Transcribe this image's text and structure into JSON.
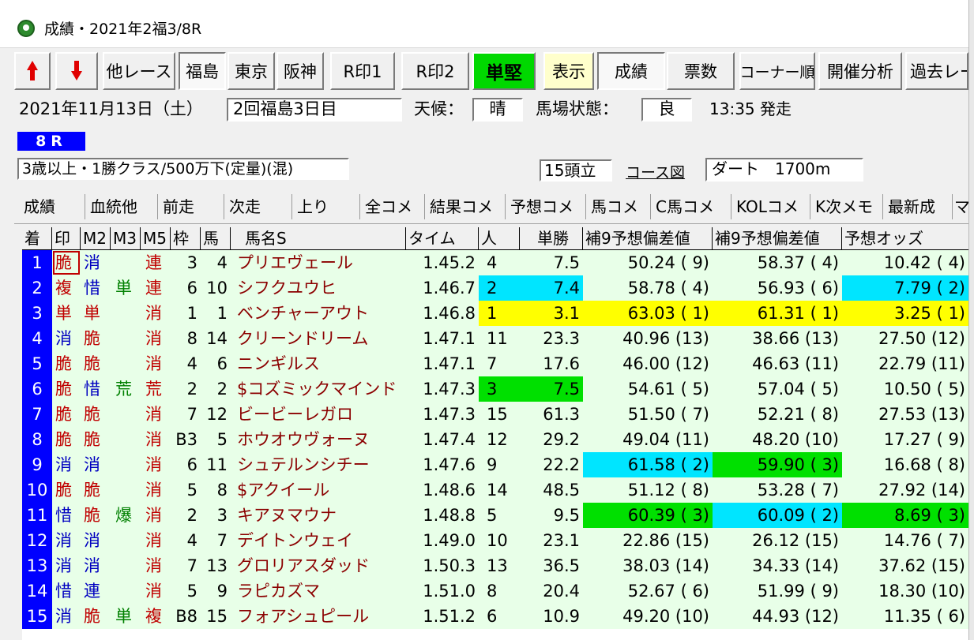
{
  "window": {
    "title": "成績・2021年2福3/8R"
  },
  "toolbar": {
    "other_race": "他レース",
    "fukushima": "福島",
    "tokyo": "東京",
    "hanshin": "阪神",
    "r_in1": "R印1",
    "r_in2": "R印2",
    "tanken": "単堅",
    "hyoji": "表示",
    "seiseki": "成績",
    "hyosu": "票数",
    "corner": "コーナー順",
    "kaisai": "開催分析",
    "kako": "過去レース"
  },
  "race": {
    "date": "2021年11月13日（土）",
    "meeting": "2回福島3日目",
    "weather_label": "天候：",
    "weather": "晴",
    "track_label": "馬場状態：",
    "track": "良",
    "post_time": "13:35 発走",
    "race_no": "8R",
    "class": "3歳以上・1勝クラス/500万下(定量)(混)",
    "runners": "15頭立",
    "course_link": "コース図",
    "surface": "ダート　1700m"
  },
  "tabs": [
    "成績",
    "血統他",
    "前走",
    "次走",
    "上り",
    "全コメ",
    "結果コメ",
    "予想コメ",
    "馬コメ",
    "C馬コメ",
    "KOLコメ",
    "K次メモ",
    "最新成",
    "マ"
  ],
  "grid": {
    "headers": [
      "着",
      "印",
      "M2",
      "M3",
      "M5",
      "枠",
      "馬",
      "馬名S",
      "タイム",
      "人",
      "単勝",
      "補9予想偏差値",
      "補9予想偏差値",
      "予想オッズ"
    ],
    "rows": [
      {
        "rank": "1",
        "m1": "脆",
        "m2": "消",
        "m3": "",
        "m5": "連",
        "waku": "3",
        "uma": "4",
        "name": "プリエヴェール",
        "time": "1.45.2",
        "pop": "4",
        "odds": "7.5",
        "h1": "50.24 ( 9)",
        "h2": "58.37 ( 4)",
        "yo": "10.42 ( 4)"
      },
      {
        "rank": "2",
        "m1": "複",
        "m2": "惜",
        "m3": "単",
        "m5": "連",
        "waku": "6",
        "uma": "10",
        "name": "シフクユウヒ",
        "time": "1.46.7",
        "pop": "2",
        "odds": "7.4",
        "h1": "58.78 ( 4)",
        "h2": "56.93 ( 6)",
        "yo": "7.79 ( 2)"
      },
      {
        "rank": "3",
        "m1": "単",
        "m2": "単",
        "m3": "",
        "m5": "消",
        "waku": "1",
        "uma": "1",
        "name": "ベンチャーアウト",
        "time": "1.46.8",
        "pop": "1",
        "odds": "3.1",
        "h1": "63.03 ( 1)",
        "h2": "61.31 ( 1)",
        "yo": "3.25 ( 1)"
      },
      {
        "rank": "4",
        "m1": "消",
        "m2": "脆",
        "m3": "",
        "m5": "消",
        "waku": "8",
        "uma": "14",
        "name": "クリーンドリーム",
        "time": "1.47.1",
        "pop": "11",
        "odds": "23.3",
        "h1": "40.96 (13)",
        "h2": "38.66 (13)",
        "yo": "27.50 (12)"
      },
      {
        "rank": "5",
        "m1": "脆",
        "m2": "脆",
        "m3": "",
        "m5": "消",
        "waku": "4",
        "uma": "6",
        "name": "ニンギルス",
        "time": "1.47.1",
        "pop": "7",
        "odds": "17.6",
        "h1": "46.00 (12)",
        "h2": "46.63 (11)",
        "yo": "22.79 (11)"
      },
      {
        "rank": "6",
        "m1": "脆",
        "m2": "惜",
        "m3": "荒",
        "m5": "荒",
        "waku": "2",
        "uma": "2",
        "name": "$コズミックマインド",
        "time": "1.47.3",
        "pop": "3",
        "odds": "7.5",
        "h1": "54.61 ( 5)",
        "h2": "57.04 ( 5)",
        "yo": "10.50 ( 5)"
      },
      {
        "rank": "7",
        "m1": "脆",
        "m2": "脆",
        "m3": "",
        "m5": "消",
        "waku": "7",
        "uma": "12",
        "name": "ビービーレガロ",
        "time": "1.47.3",
        "pop": "15",
        "odds": "61.3",
        "h1": "51.50 ( 7)",
        "h2": "52.21 ( 8)",
        "yo": "27.53 (13)"
      },
      {
        "rank": "8",
        "m1": "脆",
        "m2": "脆",
        "m3": "",
        "m5": "消",
        "waku": "B3",
        "uma": "5",
        "name": "ホウオウヴォーヌ",
        "time": "1.47.4",
        "pop": "12",
        "odds": "29.2",
        "h1": "49.04 (11)",
        "h2": "48.20 (10)",
        "yo": "17.27 ( 9)"
      },
      {
        "rank": "9",
        "m1": "消",
        "m2": "消",
        "m3": "",
        "m5": "消",
        "waku": "6",
        "uma": "11",
        "name": "シュテルンシチー",
        "time": "1.47.6",
        "pop": "9",
        "odds": "22.2",
        "h1": "61.58 ( 2)",
        "h2": "59.90 ( 3)",
        "yo": "16.68 ( 8)"
      },
      {
        "rank": "10",
        "m1": "脆",
        "m2": "脆",
        "m3": "",
        "m5": "消",
        "waku": "5",
        "uma": "8",
        "name": "$アクイール",
        "time": "1.48.6",
        "pop": "14",
        "odds": "48.5",
        "h1": "51.12 ( 8)",
        "h2": "53.28 ( 7)",
        "yo": "27.92 (14)"
      },
      {
        "rank": "11",
        "m1": "惜",
        "m2": "脆",
        "m3": "爆",
        "m5": "消",
        "waku": "2",
        "uma": "3",
        "name": "キアヌマウナ",
        "time": "1.48.8",
        "pop": "5",
        "odds": "9.5",
        "h1": "60.39 ( 3)",
        "h2": "60.09 ( 2)",
        "yo": "8.69 ( 3)"
      },
      {
        "rank": "12",
        "m1": "消",
        "m2": "消",
        "m3": "",
        "m5": "消",
        "waku": "4",
        "uma": "7",
        "name": "デイトンウェイ",
        "time": "1.49.0",
        "pop": "10",
        "odds": "23.1",
        "h1": "22.86 (15)",
        "h2": "26.12 (15)",
        "yo": "14.76 ( 7)"
      },
      {
        "rank": "13",
        "m1": "消",
        "m2": "消",
        "m3": "",
        "m5": "消",
        "waku": "7",
        "uma": "13",
        "name": "グロリアスダッド",
        "time": "1.50.3",
        "pop": "13",
        "odds": "36.5",
        "h1": "38.03 (14)",
        "h2": "34.33 (14)",
        "yo": "37.62 (15)"
      },
      {
        "rank": "14",
        "m1": "惜",
        "m2": "連",
        "m3": "",
        "m5": "消",
        "waku": "5",
        "uma": "9",
        "name": "ラピカズマ",
        "time": "1.51.0",
        "pop": "8",
        "odds": "20.4",
        "h1": "52.67 ( 6)",
        "h2": "51.99 ( 9)",
        "yo": "18.30 (10)"
      },
      {
        "rank": "15",
        "m1": "消",
        "m2": "脆",
        "m3": "単",
        "m5": "複",
        "waku": "B8",
        "uma": "15",
        "name": "フォアシュピール",
        "time": "1.51.2",
        "pop": "6",
        "odds": "10.9",
        "h1": "49.20 (10)",
        "h2": "44.93 (12)",
        "yo": "11.35 ( 6)"
      }
    ]
  },
  "colors": {
    "rank_bg": "#0000ff",
    "row_bg": "#e8ffe8",
    "highlight_cyan": "#00e5ff",
    "highlight_yellow": "#ffff00",
    "highlight_green": "#00e000",
    "mark_red": "#c00000",
    "mark_blue": "#0000c0",
    "mark_green": "#008000",
    "horse_name": "#8b0000"
  }
}
